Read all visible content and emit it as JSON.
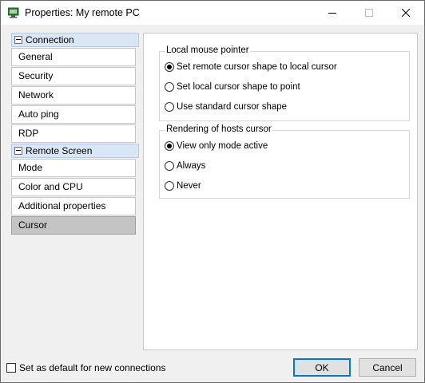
{
  "window": {
    "title": "Properties: My remote PC"
  },
  "sidebar": {
    "sections": [
      {
        "label": "Connection",
        "items": [
          {
            "label": "General"
          },
          {
            "label": "Security"
          },
          {
            "label": "Network"
          },
          {
            "label": "Auto ping"
          },
          {
            "label": "RDP"
          }
        ]
      },
      {
        "label": "Remote Screen",
        "items": [
          {
            "label": "Mode"
          },
          {
            "label": "Color and CPU"
          },
          {
            "label": "Additional properties"
          },
          {
            "label": "Cursor",
            "selected": true
          }
        ]
      }
    ]
  },
  "content": {
    "groups": [
      {
        "label": "Local mouse pointer",
        "options": [
          {
            "label": "Set remote cursor shape to local cursor",
            "checked": true
          },
          {
            "label": "Set local cursor shape to point",
            "checked": false
          },
          {
            "label": "Use standard cursor shape",
            "checked": false
          }
        ]
      },
      {
        "label": "Rendering of hosts cursor",
        "options": [
          {
            "label": "View only mode active",
            "checked": true
          },
          {
            "label": "Always",
            "checked": false
          },
          {
            "label": "Never",
            "checked": false
          }
        ]
      }
    ]
  },
  "footer": {
    "default_checkbox_label": "Set as default for new connections",
    "default_checked": false,
    "ok_label": "OK",
    "cancel_label": "Cancel"
  },
  "icons": {
    "app": "remote-pc-icon",
    "minimize": "minimize-icon",
    "maximize": "maximize-icon",
    "close": "close-icon"
  }
}
